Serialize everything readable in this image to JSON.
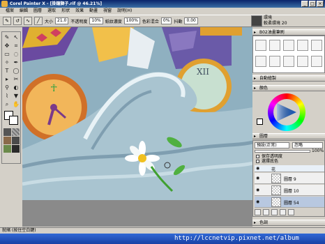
{
  "window": {
    "title": "Corel Painter X - [掛鐘獅子.rif @ 46.21%]"
  },
  "menu": [
    "檔案",
    "編輯",
    "圖層",
    "選取",
    "形狀",
    "效果",
    "動畫",
    "視窗",
    "說明(H)"
  ],
  "propbar": {
    "size_label": "大小",
    "size_value": "21.0",
    "opacity_label": "不透明度",
    "opacity_value": "10%",
    "grain_label": "紙紋濃度",
    "grain_value": "100%",
    "resat_label": "色彩混合",
    "resat_value": "0%",
    "bleed_label": "抖動",
    "bleed_value": "0.00"
  },
  "brush_info": {
    "line1": "環境",
    "line2": "較柔環境 20"
  },
  "panels": {
    "brushes": "B02油畫筆刷",
    "auto_paint": "自動繪製",
    "colors": "顏色",
    "layers": "圖層",
    "color_sets": "色調"
  },
  "layers": {
    "composite_method": "預設(正常)",
    "mode": "忽略",
    "opacity_value": "100%",
    "preserve_transparency": "保存透明度",
    "pick_up_color": "選擇底色",
    "items": [
      {
        "name": "花"
      },
      {
        "name": "圖層 9"
      },
      {
        "name": "圖層 10"
      },
      {
        "name": "圖層 54"
      }
    ]
  },
  "status": {
    "text": "就緒 (按住空白鍵)"
  },
  "watermark": "http://lccnetvip.pixnet.net/album",
  "colors": {
    "titlebar": "#0a246a",
    "taskbar": "#1941a5",
    "wave": "#9bb8c4",
    "clock_face": "#f2b65a"
  }
}
